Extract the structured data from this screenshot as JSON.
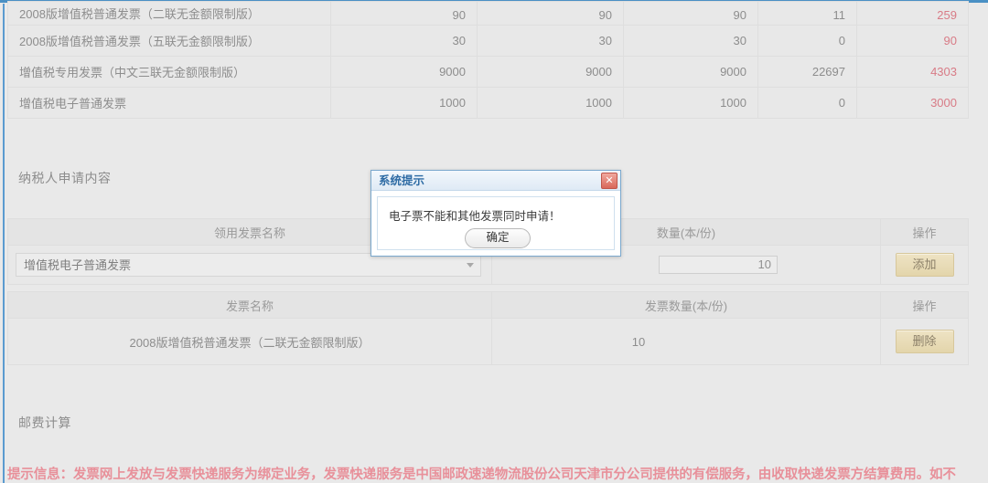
{
  "stock_table": {
    "rows": [
      {
        "name": "2008版增值税普通发票（二联无金额限制版）",
        "c1": "90",
        "c2": "90",
        "c3": "90",
        "c4": "11",
        "c5": "259",
        "clipped": true
      },
      {
        "name": "2008版增值税普通发票（五联无金额限制版）",
        "c1": "30",
        "c2": "30",
        "c3": "30",
        "c4": "0",
        "c5": "90",
        "clipped": false
      },
      {
        "name": "增值税专用发票（中文三联无金额限制版）",
        "c1": "9000",
        "c2": "9000",
        "c3": "9000",
        "c4": "22697",
        "c5": "4303",
        "clipped": false
      },
      {
        "name": "增值税电子普通发票",
        "c1": "1000",
        "c2": "1000",
        "c3": "1000",
        "c4": "0",
        "c5": "3000",
        "clipped": false
      }
    ]
  },
  "apply_section": {
    "title": "纳税人申请内容",
    "headers": {
      "invoice_name": "领用发票名称",
      "quantity": "数量(本/份)",
      "action": "操作"
    },
    "select_value": "增值税电子普通发票",
    "qty_value": "10",
    "add_label": "添加"
  },
  "added_section": {
    "headers": {
      "invoice_name": "发票名称",
      "quantity": "发票数量(本/份)",
      "action": "操作"
    },
    "row": {
      "name": "2008版增值税普通发票（二联无金额限制版）",
      "qty": "10",
      "delete_label": "删除"
    }
  },
  "postage_section": {
    "title": "邮费计算",
    "notice": "提示信息：发票网上发放与发票快递服务为绑定业务，发票快递服务是中国邮政速递物流股份公司天津市分公司提供的有偿服务，由收取快递发票方结算费用。如不"
  },
  "modal": {
    "title": "系统提示",
    "message": "电子票不能和其他发票同时申请！",
    "ok_label": "确定",
    "close_glyph": "✕"
  },
  "colors": {
    "accent_blue": "#4a90c4",
    "notice_red": "#e8909a",
    "value_red": "#d87b86",
    "button_gold": "#e3d5ab"
  }
}
